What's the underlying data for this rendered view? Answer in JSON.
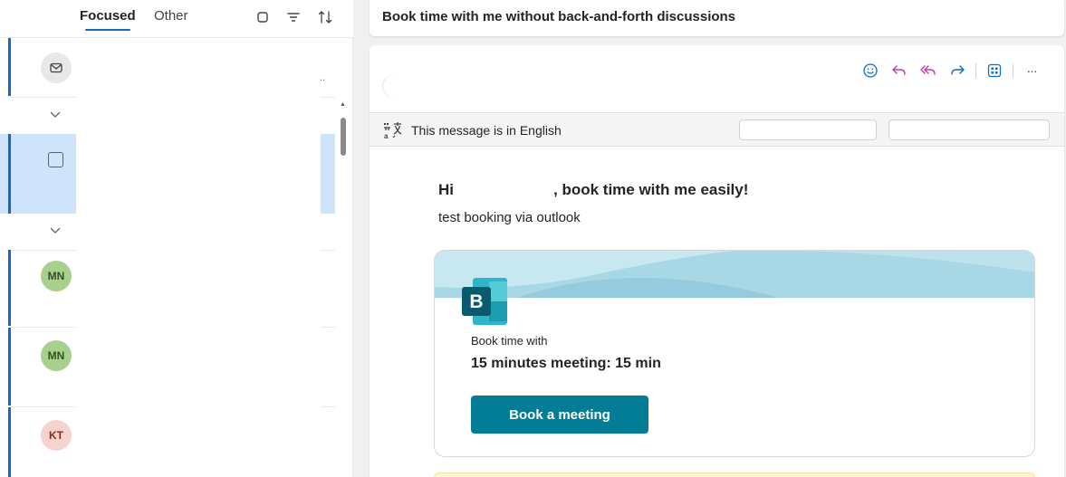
{
  "list": {
    "tabs": [
      {
        "label": "Focused",
        "selected": true
      },
      {
        "label": "Other",
        "selected": false
      }
    ],
    "header_icons": [
      "select-icon",
      "filter-icon",
      "sort-icon"
    ],
    "snippet_fragment": "/ ...",
    "avatars": [
      "MN",
      "MN",
      "KT"
    ]
  },
  "reading": {
    "subject": "Book time with me without back-and-forth discussions",
    "toolbar_icons": [
      "emoji-icon",
      "reply-icon",
      "reply-all-icon",
      "forward-icon",
      "apps-icon",
      "more-icon"
    ],
    "more_label": "···",
    "translate_text": "This message is in English",
    "greeting_start": "Hi",
    "greeting_end": ", book time with me easily!",
    "sub_line": "test booking via outlook",
    "booking": {
      "logo_letter": "B",
      "label": "Book time with",
      "title": "15 minutes meeting: 15 min",
      "button": "Book a meeting"
    }
  },
  "colors": {
    "accent": "#0f6cbd",
    "selected_row": "#cfe4fa",
    "booking_button": "#037c95",
    "banner": "#a8d8e6",
    "reply_icon": "#c239b3",
    "forward_icon": "#0f6cbd"
  }
}
